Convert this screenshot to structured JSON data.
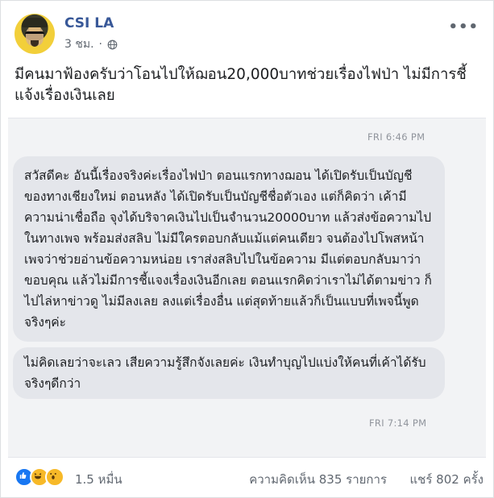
{
  "post": {
    "page_name": "CSI LA",
    "time": "3 ชม.",
    "separator": "·",
    "text": "มีคนมาฟ้องครับว่าโอนไปให้ฌอน20,000บาทช่วยเรื่องไฟป่า ไม่มีการชี้แจ้งเรื่องเงินเลย"
  },
  "screenshot": {
    "timestamp_1": "FRI 6:46 PM",
    "message_1": "สวัสดีคะ อันนี้เรื่องจริงค่ะเรื่องไฟป่า ตอนแรกทางฌอน ได้เปิดรับเป็นบัญชีของทางเชียงใหม่ ตอนหลัง ได้เปิดรับเป็นบัญชีชื่อตัวเอง แต่ก็คิดว่า เค้ามีความน่าเชื่อถือ จุงได้บริจาคเงินไปเป็นจำนวน20000บาท แล้วส่งข้อความไปในทางเพจ พร้อมส่งสลิบ ไม่มีใครตอบกลับแม้แต่คนเดียว จนต้องไปโพสหน้าเพจว่าช่วยอ่านข้อความหน่อย เราส่งสลิบไปในข้อความ มีแต่ตอบกลับมาว่าขอบคุณ แล้วไม่มีการชี้แจงเรื่องเงินอีกเลย ตอนแรกคิดว่าเราไม่ได้ตามข่าว ก็ไปไล่หาข่าวดู ไม่มีลงเลย ลงแต่เรื่องอื่น แต่สุดท้ายแล้วก็เป็นแบบที่เพจนี้พูดจริงๆค่ะ",
    "message_2": "ไม่คิดเลยว่าจะเลว เสียความรู้สึกจังเลยค่ะ เงินทำบุญไปแบ่งให้คนที่เค้าได้รับจริงๆดีกว่า",
    "timestamp_2": "FRI 7:14 PM"
  },
  "footer": {
    "reaction_icons": [
      "like-icon",
      "haha-icon",
      "wow-icon"
    ],
    "reaction_count": "1.5 หมื่น",
    "comments": "ความคิดเห็น 835 รายการ",
    "shares": "แชร์ 802 ครั้ง"
  },
  "colors": {
    "page_name": "#385898",
    "bubble": "#e4e6eb",
    "like": "#1877f2",
    "haha": "#f7b928"
  }
}
